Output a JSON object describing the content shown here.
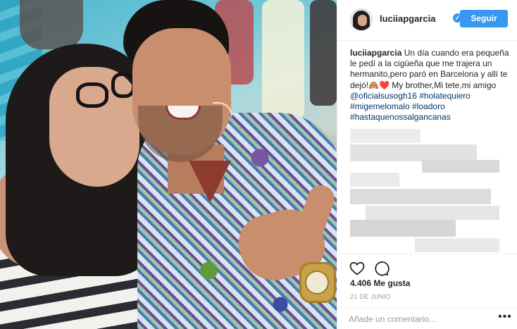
{
  "post": {
    "username": "luciiapgarcia",
    "verified_icon": "verified-badge-icon",
    "follow_label": "Seguir",
    "caption": {
      "user": "luciiapgarcia",
      "text": "Un día cuando era pequeña le pedí a la cigüeña que me trajera un hermanito,pero paró en Barcelona y allí te dejó!🙈❤️ My brother,Mi tete,mi amigo",
      "mention": "@oficialsusogh16",
      "hashtags_line1": "#holatequiero #migemelomalo #loadoro",
      "hashtags_line2": "#hastaquenossalgancanas"
    },
    "likes": "4.406 Me gusta",
    "date": "21 DE JUNIO",
    "comment_placeholder": "Añade un comentario...",
    "more_label": "•••"
  },
  "colors": {
    "accent": "#3897f0",
    "link": "#003569",
    "text": "#262626",
    "muted": "#999999"
  },
  "icons": [
    "heart-icon",
    "comment-icon",
    "verified-badge-icon",
    "more-options-icon"
  ]
}
